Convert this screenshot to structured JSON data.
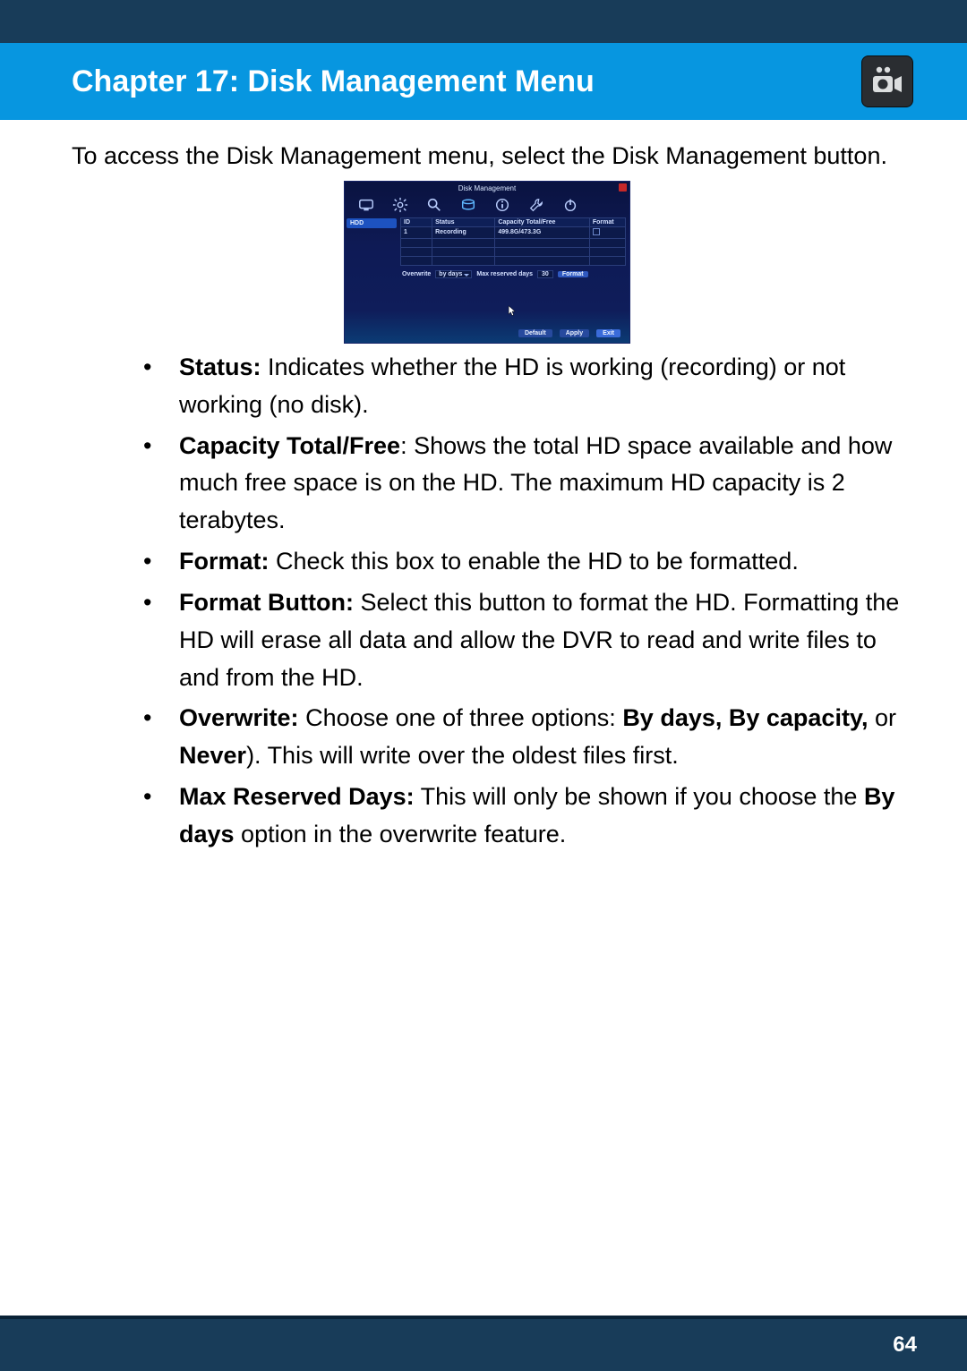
{
  "header": {
    "title": "Chapter 17: Disk Management Menu"
  },
  "intro": "To access the Disk Management menu, select the Disk Management button.",
  "screenshot": {
    "title": "Disk Management",
    "sidebar_tab": "HDD",
    "columns": {
      "id": "ID",
      "status": "Status",
      "capacity": "Capacity Total/Free",
      "format": "Format"
    },
    "row": {
      "id": "1",
      "status": "Recording",
      "capacity": "499.8G/473.3G"
    },
    "controls": {
      "overwrite_label": "Overwrite",
      "overwrite_value": "by days",
      "max_days_label": "Max reserved days",
      "max_days_value": "30",
      "format_btn": "Format"
    },
    "footer": {
      "default": "Default",
      "apply": "Apply",
      "exit": "Exit"
    }
  },
  "bullets": [
    {
      "label": "Status:",
      "text": " Indicates whether the HD is working (recording) or not working (no disk)."
    },
    {
      "label": "Capacity Total/Free",
      "text": ": Shows the total HD space available and how much free space is on the HD. The maximum HD capacity is 2 terabytes."
    },
    {
      "label": "Format:",
      "text": " Check this box to enable the HD to be formatted."
    },
    {
      "label": "Format Button:",
      "text": " Select this button to format the HD. Formatting the HD will erase all data and allow the DVR to read and write files to and from the HD."
    },
    {
      "label": "Overwrite:",
      "pre": " Choose one of three options: ",
      "opts": "By days, By capacity,",
      "mid": " or ",
      "never": "Never",
      "post": "). This will write over the oldest files first."
    },
    {
      "label": "Max Reserved Days:",
      "pre": " This will only be shown if you choose the ",
      "bydays": "By days",
      "post": " option in the overwrite feature."
    }
  ],
  "page_number": "64"
}
